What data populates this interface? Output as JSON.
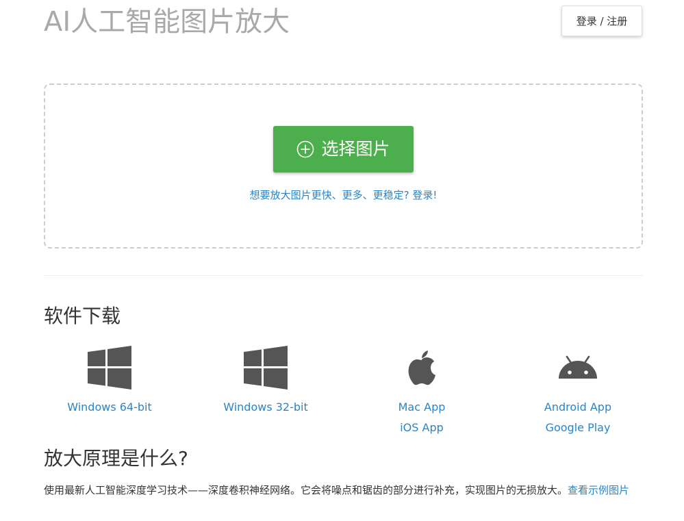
{
  "header": {
    "title": "AI人工智能图片放大",
    "login_label": "登录 / 注册"
  },
  "upload": {
    "button_label": "选择图片",
    "login_hint": "想要放大图片更快、更多、更稳定? 登录!"
  },
  "downloads": {
    "title": "软件下载",
    "items": [
      {
        "icon": "windows-icon",
        "links": [
          "Windows 64-bit"
        ]
      },
      {
        "icon": "windows-icon",
        "links": [
          "Windows 32-bit"
        ]
      },
      {
        "icon": "apple-icon",
        "links": [
          "Mac App",
          "iOS App"
        ]
      },
      {
        "icon": "android-icon",
        "links": [
          "Android App",
          "Google Play"
        ]
      }
    ]
  },
  "principle": {
    "title": "放大原理是什么?",
    "text": "使用最新人工智能深度学习技术——深度卷积神经网络。它会将噪点和锯齿的部分进行补充，实现图片的无损放大。",
    "link_label": "查看示例图片"
  },
  "colors": {
    "accent_green": "#4cae4c",
    "link_blue": "#2a84c6",
    "title_gray": "#a9a9a9",
    "icon_gray": "#555555"
  }
}
